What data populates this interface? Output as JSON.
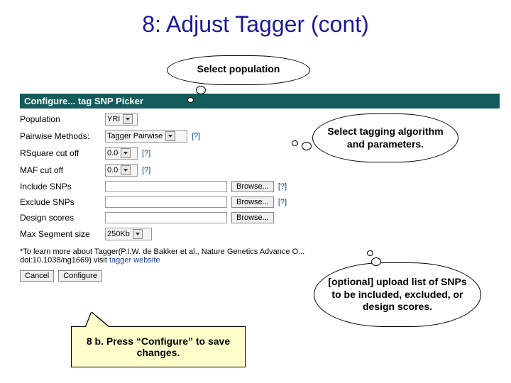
{
  "slide": {
    "title": "8: Adjust Tagger (cont)"
  },
  "callouts": {
    "population": "Select population",
    "algorithm": "Select tagging algorithm and parameters.",
    "upload": "[optional] upload list of SNPs to be included, excluded, or design scores.",
    "configure": "8 b. Press “Configure” to save changes."
  },
  "form": {
    "header": "Configure... tag SNP Picker",
    "rows": {
      "population": {
        "label": "Population",
        "value": "YRI"
      },
      "pairwise": {
        "label": "Pairwise Methods:",
        "value": "Tagger Pairwise",
        "help": "[?]"
      },
      "rsquare": {
        "label": "RSquare cut off",
        "value": "0.0",
        "help": "[?]"
      },
      "maf": {
        "label": "MAF cut off",
        "value": "0.0",
        "help": "[?]"
      },
      "include": {
        "label": "Include SNPs",
        "browse": "Browse...",
        "help": "[?]"
      },
      "exclude": {
        "label": "Exclude SNPs",
        "browse": "Browse...",
        "help": "[?]"
      },
      "design": {
        "label": "Design scores",
        "browse": "Browse..."
      },
      "maxseg": {
        "label": "Max Segment size",
        "value": "250Kb"
      }
    },
    "footnote_a": "*To learn more about Tagger(P.I.W. de Bakker et al., Nature Genetics Advance O...",
    "footnote_b": "doi:10.1038/ng1669) visit ",
    "footnote_link": "tagger website",
    "cancel": "Cancel",
    "configure": "Configure"
  }
}
